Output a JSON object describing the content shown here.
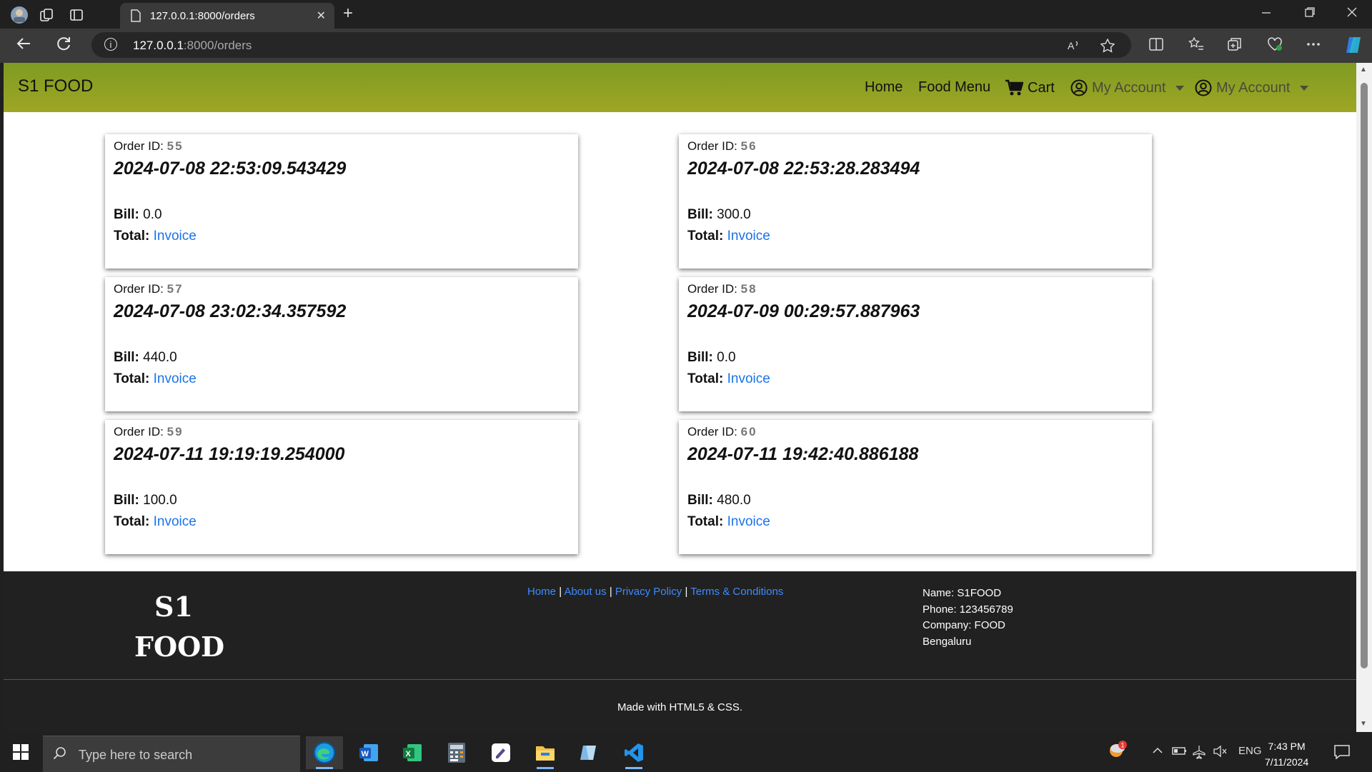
{
  "browser": {
    "tab_title": "127.0.0.1:8000/orders",
    "tab_close": "✕",
    "new_tab": "+",
    "url_host": "127.0.0.1",
    "url_path": ":8000/orders"
  },
  "navbar": {
    "brand": "S1 FOOD",
    "home": "Home",
    "menu": "Food Menu",
    "cart": "Cart",
    "account1": "My Account",
    "account2": "My Account"
  },
  "orders": [
    {
      "id_label": "Order ID:",
      "id": "55",
      "timestamp": "2024-07-08 22:53:09.543429",
      "bill_label": "Bill:",
      "bill": "0.0",
      "total_label": "Total:",
      "invoice": "Invoice"
    },
    {
      "id_label": "Order ID:",
      "id": "56",
      "timestamp": "2024-07-08 22:53:28.283494",
      "bill_label": "Bill:",
      "bill": "300.0",
      "total_label": "Total:",
      "invoice": "Invoice"
    },
    {
      "id_label": "Order ID:",
      "id": "57",
      "timestamp": "2024-07-08 23:02:34.357592",
      "bill_label": "Bill:",
      "bill": "440.0",
      "total_label": "Total:",
      "invoice": "Invoice"
    },
    {
      "id_label": "Order ID:",
      "id": "58",
      "timestamp": "2024-07-09 00:29:57.887963",
      "bill_label": "Bill:",
      "bill": "0.0",
      "total_label": "Total:",
      "invoice": "Invoice"
    },
    {
      "id_label": "Order ID:",
      "id": "59",
      "timestamp": "2024-07-11 19:19:19.254000",
      "bill_label": "Bill:",
      "bill": "100.0",
      "total_label": "Total:",
      "invoice": "Invoice"
    },
    {
      "id_label": "Order ID:",
      "id": "60",
      "timestamp": "2024-07-11 19:42:40.886188",
      "bill_label": "Bill:",
      "bill": "480.0",
      "total_label": "Total:",
      "invoice": "Invoice"
    }
  ],
  "footer": {
    "logo_line1": "S1",
    "logo_line2": "FOOD",
    "links": [
      "Home",
      "About us",
      "Privacy Policy",
      "Terms & Conditions"
    ],
    "separator": "|",
    "info": [
      "Name: S1FOOD",
      "Phone: 123456789",
      "Company: FOOD",
      "Bengaluru"
    ],
    "made_with": "Made with HTML5 & CSS."
  },
  "taskbar": {
    "search_placeholder": "Type here to search",
    "language": "ENG",
    "time": "7:43 PM",
    "date": "7/11/2024",
    "weather_badge": "1"
  },
  "colors": {
    "navbar_top": "#7e9b22",
    "navbar_bottom": "#9fa624",
    "link_blue": "#1a73e8",
    "footer_bg": "#212121"
  }
}
